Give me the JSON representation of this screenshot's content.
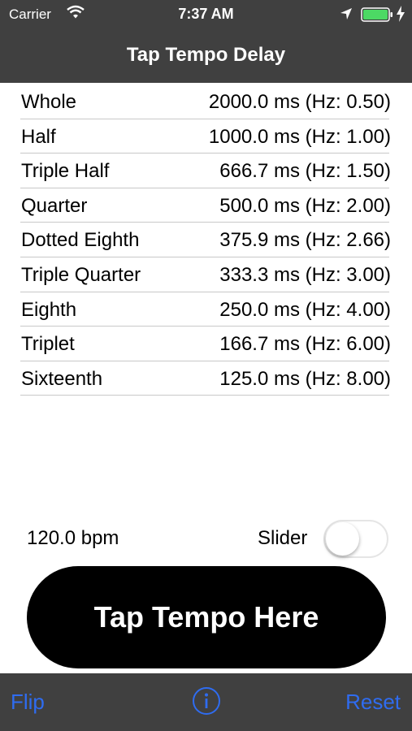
{
  "status": {
    "carrier": "Carrier",
    "time": "7:37 AM"
  },
  "nav": {
    "title": "Tap Tempo Delay"
  },
  "rows": [
    {
      "name": "Whole",
      "value": "2000.0 ms (Hz: 0.50)"
    },
    {
      "name": "Half",
      "value": "1000.0 ms (Hz: 1.00)"
    },
    {
      "name": "Triple Half",
      "value": "666.7 ms (Hz: 1.50)"
    },
    {
      "name": "Quarter",
      "value": "500.0 ms (Hz: 2.00)"
    },
    {
      "name": "Dotted Eighth",
      "value": "375.9 ms (Hz: 2.66)"
    },
    {
      "name": "Triple Quarter",
      "value": "333.3 ms (Hz: 3.00)"
    },
    {
      "name": "Eighth",
      "value": "250.0 ms (Hz: 4.00)"
    },
    {
      "name": "Triplet",
      "value": "166.7 ms (Hz: 6.00)"
    },
    {
      "name": "Sixteenth",
      "value": "125.0 ms (Hz: 8.00)"
    }
  ],
  "controls": {
    "bpm": "120.0 bpm",
    "slider_label": "Slider",
    "slider_on": false
  },
  "tap_button": "Tap Tempo Here",
  "toolbar": {
    "flip": "Flip",
    "reset": "Reset",
    "info_icon": "info-icon"
  },
  "colors": {
    "bar": "#404040",
    "accent": "#2f6cf0",
    "battery": "#4cd964"
  }
}
